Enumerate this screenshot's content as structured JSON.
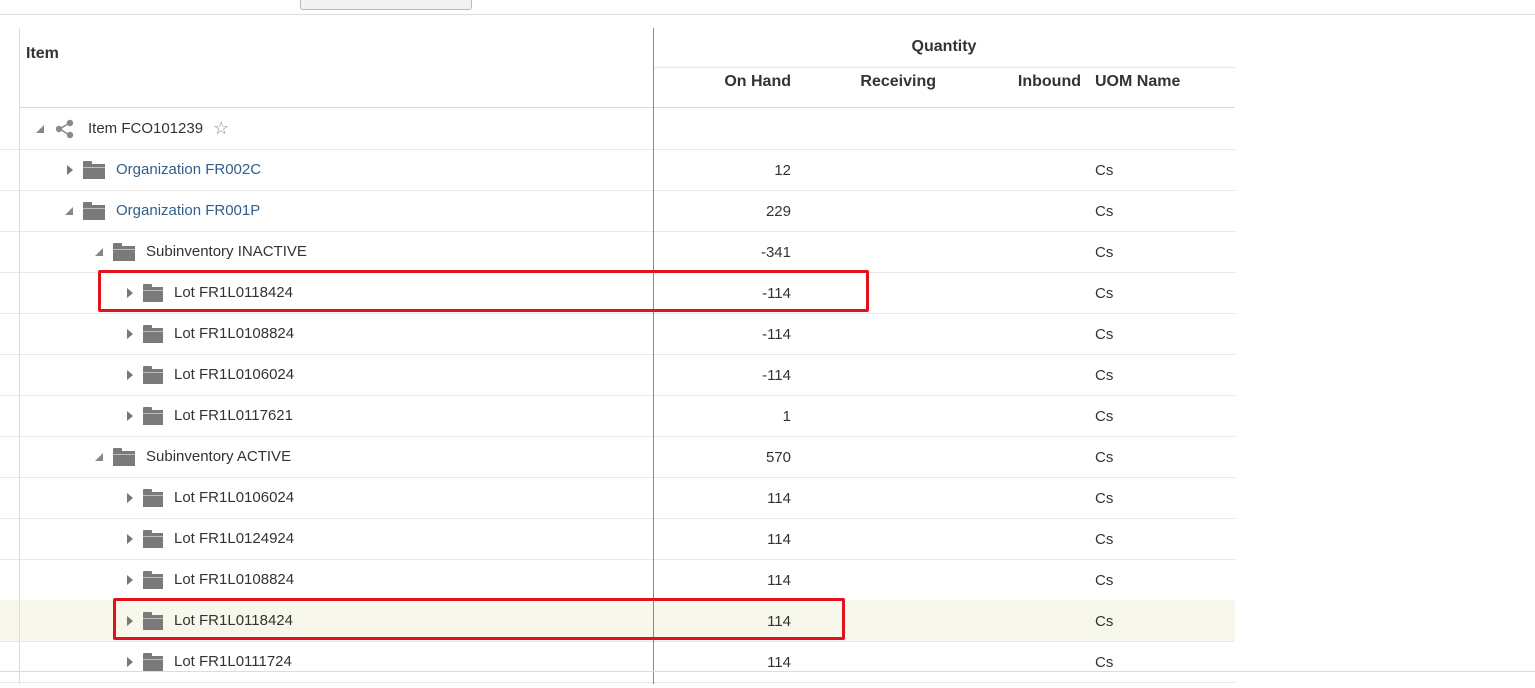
{
  "header": {
    "item": "Item",
    "quantity": "Quantity",
    "on_hand": "On Hand",
    "receiving": "Receiving",
    "inbound": "Inbound",
    "uom_name": "UOM Name"
  },
  "rows": [
    {
      "label": "Item FCO101239",
      "type": "item",
      "expanded": true,
      "on_hand": "",
      "uom": ""
    },
    {
      "label": "Organization FR002C",
      "type": "organization",
      "expanded": false,
      "on_hand": "12",
      "uom": "Cs"
    },
    {
      "label": "Organization FR001P",
      "type": "organization",
      "expanded": true,
      "on_hand": "229",
      "uom": "Cs"
    },
    {
      "label": "Subinventory INACTIVE",
      "type": "subinventory",
      "expanded": true,
      "on_hand": "-341",
      "uom": "Cs"
    },
    {
      "label": "Lot FR1L0118424",
      "type": "lot",
      "expanded": false,
      "on_hand": "-114",
      "uom": "Cs",
      "highlighted": true
    },
    {
      "label": "Lot FR1L0108824",
      "type": "lot",
      "expanded": false,
      "on_hand": "-114",
      "uom": "Cs"
    },
    {
      "label": "Lot FR1L0106024",
      "type": "lot",
      "expanded": false,
      "on_hand": "-114",
      "uom": "Cs"
    },
    {
      "label": "Lot FR1L0117621",
      "type": "lot",
      "expanded": false,
      "on_hand": "1",
      "uom": "Cs"
    },
    {
      "label": "Subinventory ACTIVE",
      "type": "subinventory",
      "expanded": true,
      "on_hand": "570",
      "uom": "Cs"
    },
    {
      "label": "Lot FR1L0106024",
      "type": "lot",
      "expanded": false,
      "on_hand": "114",
      "uom": "Cs"
    },
    {
      "label": "Lot FR1L0124924",
      "type": "lot",
      "expanded": false,
      "on_hand": "114",
      "uom": "Cs"
    },
    {
      "label": "Lot FR1L0108824",
      "type": "lot",
      "expanded": false,
      "on_hand": "114",
      "uom": "Cs"
    },
    {
      "label": "Lot FR1L0118424",
      "type": "lot",
      "expanded": false,
      "on_hand": "114",
      "uom": "Cs",
      "highlighted": true,
      "selected": true
    },
    {
      "label": "Lot FR1L0111724",
      "type": "lot",
      "expanded": false,
      "on_hand": "114",
      "uom": "Cs"
    }
  ],
  "colors": {
    "highlight": "#e0121b",
    "link": "#2f5f8a",
    "divider": "#4e9bc7",
    "selected_row": "#f7f7ec"
  }
}
